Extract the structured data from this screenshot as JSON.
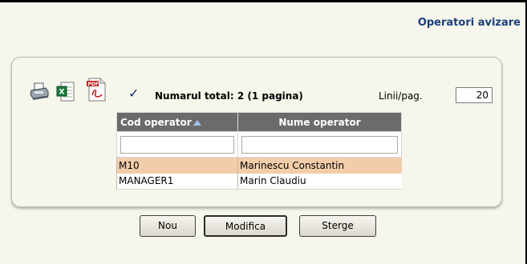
{
  "page": {
    "title": "Operatori avizare"
  },
  "toolbar": {
    "printer_icon": "printer-icon",
    "excel_icon": "excel-export-icon",
    "pdf_icon": "pdf-export-icon",
    "check_icon": "checkmark-icon",
    "check_glyph": "✓",
    "total_text": "Numarul total: 2 (1 pagina)",
    "lines_label": "Linii/pag.",
    "lines_value": "20"
  },
  "grid": {
    "columns": [
      {
        "label": "Cod operator",
        "sorted": "ascending"
      },
      {
        "label": "Nume operator"
      }
    ],
    "rows": [
      {
        "code": "M10",
        "name": "Marinescu Constantin",
        "selected": true
      },
      {
        "code": "MANAGER1",
        "name": "Marin Claudiu",
        "selected": false
      }
    ]
  },
  "buttons": {
    "new_label": "Nou",
    "modify_label": "Modifica",
    "delete_label": "Sterge"
  },
  "colors": {
    "title": "#1c3e7c",
    "header_bg": "#6b6b6b",
    "selected_row": "#f3cdaa",
    "background": "#f6f6ec"
  }
}
